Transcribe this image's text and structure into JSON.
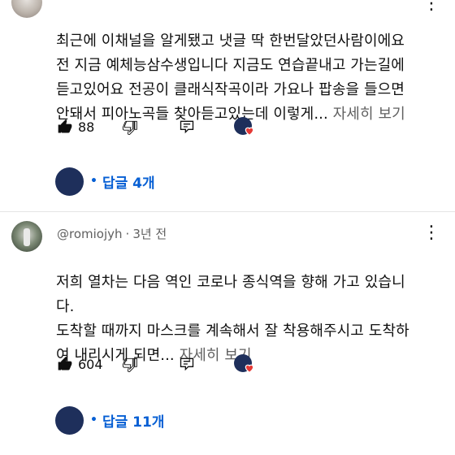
{
  "comments": [
    {
      "meta_partial": "",
      "text": "최근에 이채널을 알게됐고 냇글 딱 한번달았던사람이에요\n전 지금 예체능삼수생입니다 지금도 연습끝내고 가는길에\n듣고있어요 전공이 클래식작곡이라 가요나 팝송을 들으면\n안돼서 피아노곡들 찾아듣고있는데 이렇게...",
      "read_more": "자세히 보기",
      "likes": "88",
      "replies_label": "답글 4개"
    },
    {
      "username": "@romiojyh",
      "time": "3년 전",
      "text": "저희 열차는 다음 역인 코로나 종식역을 향해 가고 있습니\n다.\n도착할 때까지 마스크를 계속해서 잘 착용해주시고 도착하\n여 내리시게 되면...",
      "read_more": "자세히 보기",
      "likes": "604",
      "replies_label": "답글 11개"
    }
  ],
  "icons": {
    "like": "thumbs-up-icon",
    "dislike": "thumbs-down-icon",
    "reply": "reply-icon",
    "more": "more-vertical-icon",
    "heart": "creator-heart-icon"
  },
  "colors": {
    "link": "#065fd4",
    "heart": "#e53935",
    "avatar": "#1e2f5b"
  }
}
